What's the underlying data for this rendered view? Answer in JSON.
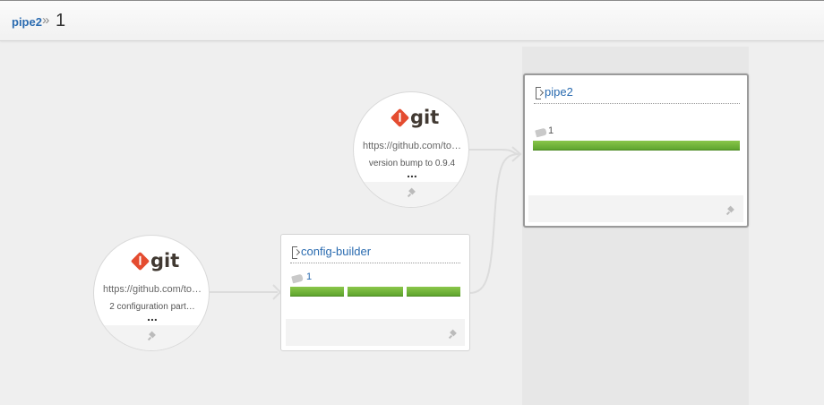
{
  "breadcrumb": {
    "pipeline": "pipe2",
    "separator": "»",
    "counter": "1"
  },
  "materials": [
    {
      "type": "git",
      "logo_text": "git",
      "url": "https://github.com/to…",
      "comment": "version bump to 0.9.4",
      "more": "...",
      "icon": "pin-icon"
    },
    {
      "type": "git",
      "logo_text": "git",
      "url": "https://github.com/to…",
      "comment": "2 configuration part…",
      "more": "...",
      "icon": "pin-icon"
    }
  ],
  "pipelines": [
    {
      "name": "pipe2",
      "counter": "1",
      "stages": 1,
      "stage_color": "#6db33f",
      "current": true
    },
    {
      "name": "config-builder",
      "counter": "1",
      "stages": 3,
      "stage_color": "#6db33f",
      "current": false
    }
  ],
  "colors": {
    "link": "#2a6bb0",
    "git": "#e44c30",
    "stage_passed": "#6db33f",
    "background": "#efefef"
  }
}
